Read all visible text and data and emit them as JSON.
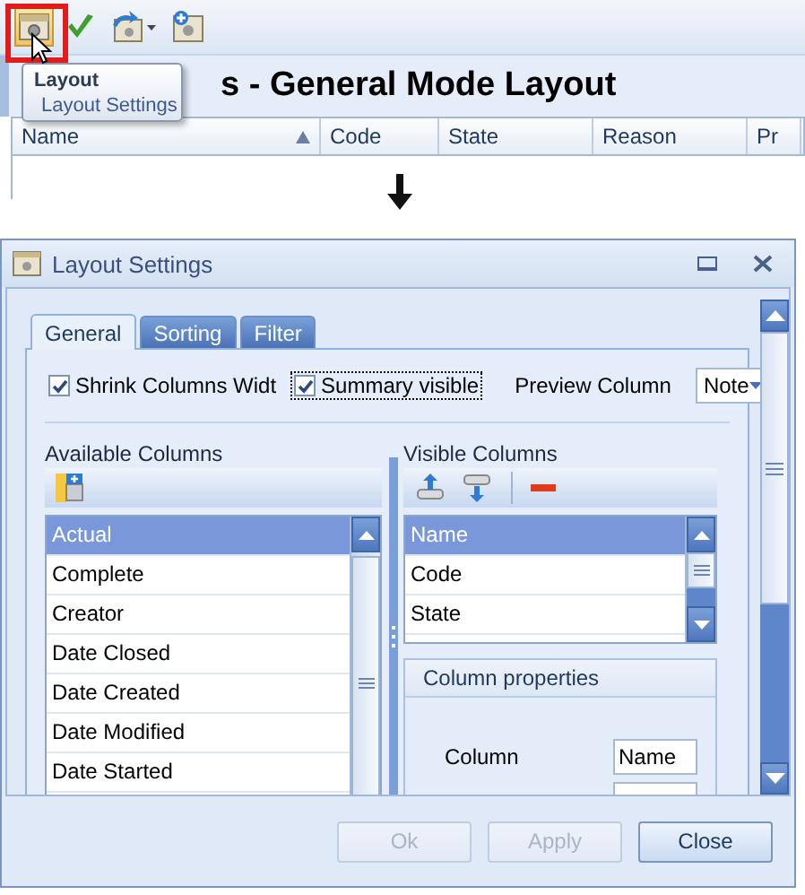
{
  "toolbar": [
    {
      "kind": "layout",
      "selected": true
    },
    {
      "kind": "check",
      "selected": false
    },
    {
      "kind": "export",
      "selected": false
    },
    {
      "kind": "add",
      "selected": false
    }
  ],
  "tooltip": {
    "title": "Layout",
    "text": "Layout Settings"
  },
  "page_title": "s - General Mode Layout",
  "grid": {
    "columns": [
      {
        "label": "Name",
        "sorted": true
      },
      {
        "label": "Code",
        "sorted": false
      },
      {
        "label": "State",
        "sorted": false
      },
      {
        "label": "Reason",
        "sorted": false
      },
      {
        "label": "Pr",
        "sorted": false
      }
    ]
  },
  "dialog": {
    "title": "Layout Settings",
    "tabs": [
      {
        "label": "General",
        "selected": true
      },
      {
        "label": "Sorting",
        "selected": false
      },
      {
        "label": "Filter",
        "selected": false
      }
    ],
    "options": [
      {
        "label": "Shrink Columns Widt",
        "checked": true,
        "focused": false
      },
      {
        "label": "Summary visible",
        "checked": true,
        "focused": true
      }
    ],
    "preview_column": {
      "label": "Preview Column",
      "value": "Note"
    },
    "available_columns": {
      "label": "Available Columns",
      "items": [
        {
          "label": "Actual",
          "selected": true
        },
        {
          "label": "Complete",
          "selected": false
        },
        {
          "label": "Creator",
          "selected": false
        },
        {
          "label": "Date Closed",
          "selected": false
        },
        {
          "label": "Date Created",
          "selected": false
        },
        {
          "label": "Date Modified",
          "selected": false
        },
        {
          "label": "Date Started",
          "selected": false
        }
      ]
    },
    "visible_columns": {
      "label": "Visible Columns",
      "items": [
        {
          "label": "Name",
          "selected": true
        },
        {
          "label": "Code",
          "selected": false
        },
        {
          "label": "State",
          "selected": false
        }
      ]
    },
    "column_properties": {
      "title": "Column properties",
      "fields": [
        {
          "label": "Column",
          "value": "Name"
        }
      ]
    },
    "buttons": [
      {
        "label": "Ok",
        "disabled": true
      },
      {
        "label": "Apply",
        "disabled": true
      },
      {
        "label": "Close",
        "disabled": false
      }
    ]
  }
}
